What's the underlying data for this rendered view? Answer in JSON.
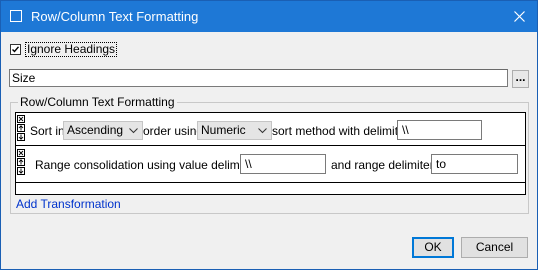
{
  "window": {
    "title": "Row/Column Text Formatting",
    "accent": "#1e78d6"
  },
  "options": {
    "ignore_headings_label": "Ignore Headings",
    "ignore_headings_checked": true
  },
  "field": {
    "value": "Size",
    "browse_label": "..."
  },
  "group": {
    "legend": "Row/Column Text Formatting",
    "rows": [
      {
        "sort_in_label": "Sort in",
        "order_value": "Ascending",
        "order_using_label": "order using",
        "method_value": "Numeric",
        "sort_method_label": "sort method with delimiter",
        "delimiter_value": "\\\\"
      },
      {
        "range_label": "Range consolidation using value delimiter",
        "value_delimiter": "\\\\",
        "and_range_label": "and range delimiter",
        "range_delimiter": "to"
      }
    ],
    "add_link": "Add Transformation"
  },
  "buttons": {
    "ok": "OK",
    "cancel": "Cancel"
  }
}
